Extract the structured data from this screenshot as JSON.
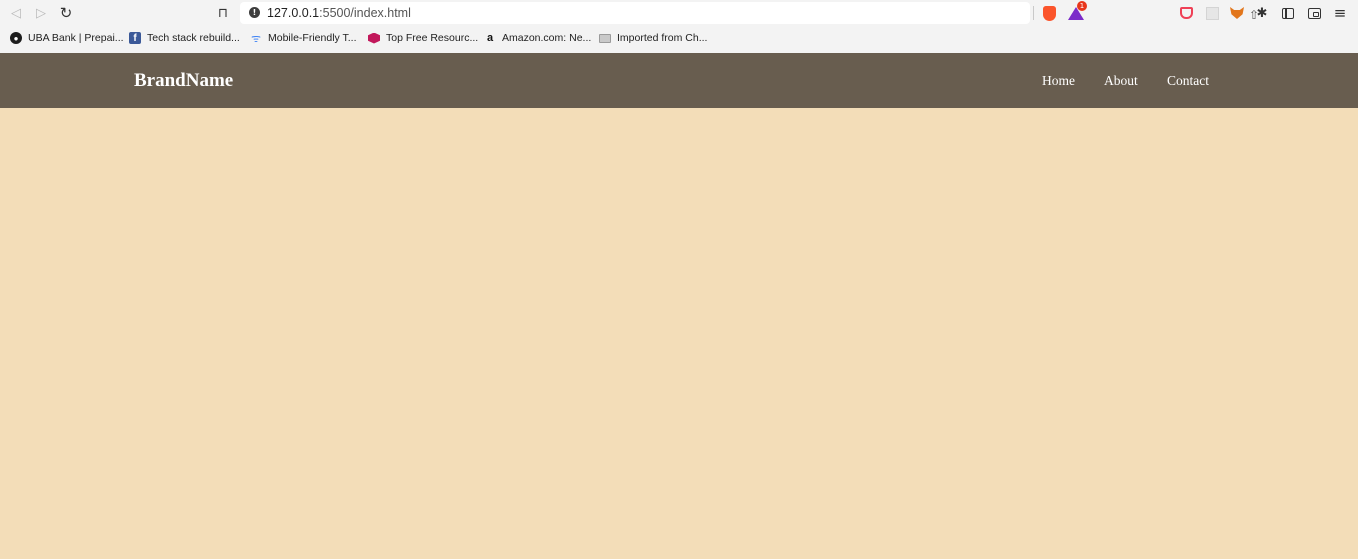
{
  "browser": {
    "url_host": "127.0.0.1",
    "url_rest": ":5500/index.html",
    "nav_glyphs": {
      "back": "◁",
      "forward": "▷",
      "reload": "↻",
      "bookmark": "⊓",
      "share": "⇧",
      "info": "!",
      "extensions": "✱",
      "menu": "≡"
    },
    "brave_badge": "1",
    "extension_icons": [
      "brave-shields-icon",
      "brave-rewards-icon",
      "pocket-icon",
      "extension-placeholder-icon",
      "metamask-icon",
      "puzzle-icon",
      "sidebar-icon",
      "wallet-icon",
      "menu-icon"
    ]
  },
  "bookmarks": [
    {
      "label": "UBA Bank | Prepai...",
      "icon": "globe-icon",
      "glyph": "●"
    },
    {
      "label": "Tech stack rebuild...",
      "icon": "facebook-icon",
      "glyph": "f"
    },
    {
      "label": "Mobile-Friendly T...",
      "icon": "mobile-test-icon",
      "glyph": "ᯤ"
    },
    {
      "label": "Top Free Resourc...",
      "icon": "hexagon-icon",
      "glyph": ""
    },
    {
      "label": "Amazon.com: Ne...",
      "icon": "amazon-icon",
      "glyph": "a"
    },
    {
      "label": "Imported from Ch...",
      "icon": "folder-icon",
      "glyph": ""
    }
  ],
  "site": {
    "brand": "BrandName",
    "nav": [
      {
        "label": "Home"
      },
      {
        "label": "About"
      },
      {
        "label": "Contact"
      }
    ],
    "colors": {
      "header_bg": "#685d4f",
      "body_bg": "#f3ddb8",
      "text": "#ffffff"
    }
  }
}
